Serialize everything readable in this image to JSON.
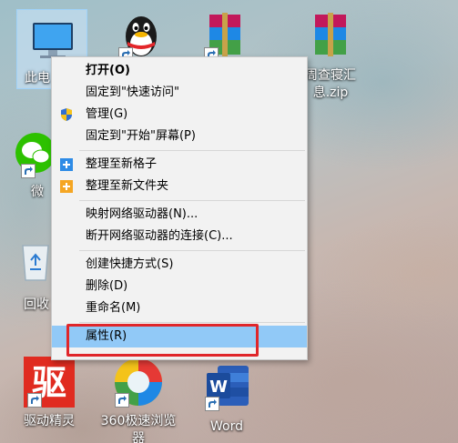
{
  "desktop": {
    "icons": {
      "this_pc": "此电",
      "qq": "",
      "winrar1": "",
      "winrar2": "周",
      "winrar2_line1": "周查寝汇",
      "winrar2_line2": "息.zip",
      "wechat": "微",
      "recycle": "回收",
      "qudong": "驱动精灵",
      "browser360_line1": "360极速浏览",
      "browser360_line2": "器",
      "word": "Word"
    }
  },
  "context_menu": {
    "items": [
      {
        "label": "打开(O)"
      },
      {
        "label": "固定到\"快速访问\""
      },
      {
        "label": "管理(G)"
      },
      {
        "label": "固定到\"开始\"屏幕(P)"
      },
      {
        "label": "整理至新格子"
      },
      {
        "label": "整理至新文件夹"
      },
      {
        "label": "映射网络驱动器(N)..."
      },
      {
        "label": "断开网络驱动器的连接(C)..."
      },
      {
        "label": "创建快捷方式(S)"
      },
      {
        "label": "删除(D)"
      },
      {
        "label": "重命名(M)"
      },
      {
        "label": "属性(R)"
      }
    ]
  },
  "colors": {
    "highlight": "#91c9f7",
    "annotation_box": "#e0262a",
    "menu_bg": "#f2f2f2"
  }
}
